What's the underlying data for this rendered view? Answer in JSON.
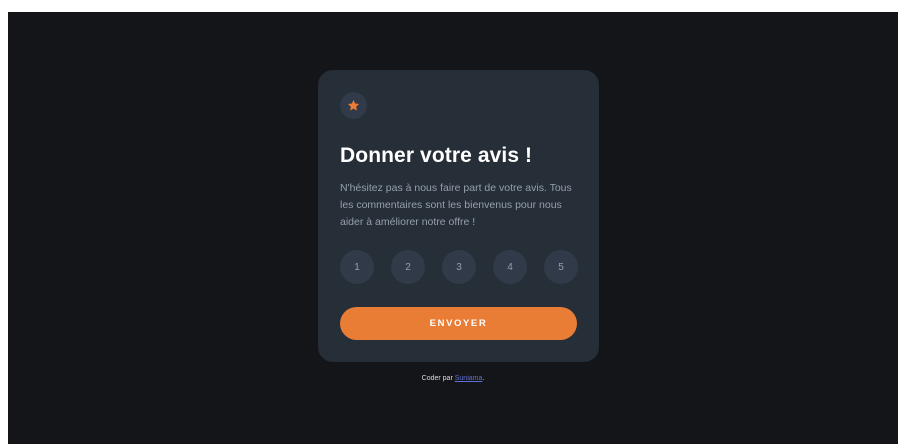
{
  "colors": {
    "page_background": "#141519",
    "card_background": "#262e38",
    "circle_background": "#313a48",
    "accent_orange": "#ea7d35",
    "muted_text": "#969fad",
    "title_text": "#ffffff",
    "link": "#5f6fd8"
  },
  "card": {
    "icon": "star-icon",
    "title": "Donner votre avis !",
    "description": "N'hésitez pas à nous faire part de votre avis. Tous les commentaires sont les bienvenus pour nous aider à améliorer notre offre !",
    "ratings": [
      "1",
      "2",
      "3",
      "4",
      "5"
    ],
    "submit_label": "ENVOYER"
  },
  "attribution": {
    "prefix": "Coder par ",
    "author": "Suniama",
    "suffix": "."
  }
}
